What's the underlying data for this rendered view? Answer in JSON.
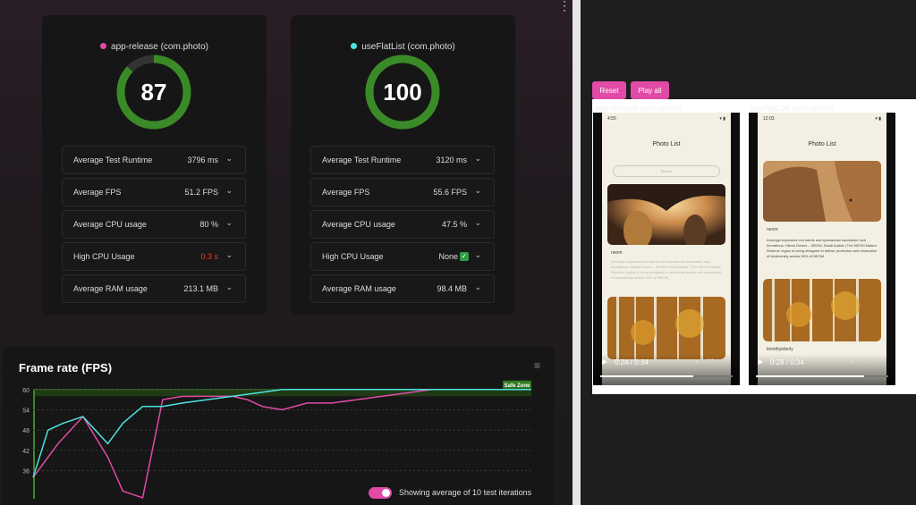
{
  "cards": [
    {
      "title": "app-release (com.photo)",
      "color": "#e14aa6",
      "score": "87",
      "score_value": 87,
      "metrics": [
        {
          "label": "Average Test Runtime",
          "value": "3796 ms"
        },
        {
          "label": "Average FPS",
          "value": "51.2 FPS"
        },
        {
          "label": "Average CPU usage",
          "value": "80 %"
        },
        {
          "label": "High CPU Usage",
          "value": "0.3 s"
        },
        {
          "label": "Average RAM usage",
          "value": "213.1 MB"
        }
      ]
    },
    {
      "title": "useFlatList (com.photo)",
      "color": "#4de3e0",
      "score": "100",
      "score_value": 100,
      "metrics": [
        {
          "label": "Average Test Runtime",
          "value": "3120 ms"
        },
        {
          "label": "Average FPS",
          "value": "55.6 FPS"
        },
        {
          "label": "Average CPU usage",
          "value": "47.5 %"
        },
        {
          "label": "High CPU Usage",
          "value": "None"
        },
        {
          "label": "Average RAM usage",
          "value": "98.4 MB"
        }
      ]
    }
  ],
  "chart": {
    "title": "Frame rate (FPS)",
    "menu_icon": "hamburger-menu-icon",
    "safe_zone_label": "Safe Zone",
    "y_ticks": [
      "60",
      "54",
      "48",
      "42",
      "36"
    ]
  },
  "chart_data": {
    "type": "line",
    "title": "Frame rate (FPS)",
    "ylim": [
      33,
      61
    ],
    "yticks": [
      60,
      54,
      48,
      42,
      36
    ],
    "series": [
      {
        "name": "app-release (com.photo)",
        "color": "#e14aa6",
        "x": [
          0,
          5,
          10,
          15,
          18,
          22,
          26,
          30,
          35,
          40,
          43,
          46,
          50,
          55,
          60,
          65,
          70,
          75,
          80,
          85,
          90,
          95,
          100
        ],
        "y": [
          34,
          44,
          52,
          40,
          30,
          28,
          57,
          58,
          58,
          58,
          57,
          55,
          54,
          56,
          56,
          57,
          58,
          59,
          60,
          60,
          60,
          60,
          60
        ]
      },
      {
        "name": "useFlatList (com.photo)",
        "color": "#4de3e0",
        "x": [
          0,
          3,
          6,
          10,
          15,
          18,
          22,
          26,
          30,
          35,
          40,
          45,
          50,
          55,
          60,
          65,
          70,
          75,
          80,
          85,
          90,
          95,
          100
        ],
        "y": [
          34,
          48,
          50,
          52,
          44,
          50,
          55,
          55,
          56,
          57,
          58,
          59,
          60,
          60,
          60,
          60,
          60,
          60,
          60,
          60,
          60,
          60,
          60
        ]
      }
    ]
  },
  "toggle": {
    "label": "Showing average of 10 test iterations",
    "on": true
  },
  "right": {
    "reset_label": "Reset",
    "play_all_label": "Play all",
    "videos": [
      {
        "title": "app-release (com.photo)",
        "status_time": "4:55",
        "screen_title": "Photo List",
        "search_placeholder": "Search",
        "caption_title": "neom",
        "caption_text": "Amongst expansive red sands and spectacular sandstone rock formations, Hisma Desert – NEOM, Saudi Arabia | The NEOM Nature Reserve region is being designed to deliver protection and restoration of biodiversity across 95% of NEOM",
        "time": "0:24 / 0:34",
        "progress": 0.7
      },
      {
        "title": "useFlatList (com.photo)",
        "status_time": "12:03",
        "screen_title": "Photo List",
        "caption_title": "neom",
        "caption_text": "Amongst expansive red sands and spectacular sandstone rock formations, Hisma Desert – NEOM, Saudi Arabia | The NEOM Nature Reserve region is being designed to deliver protection and restoration of biodiversity across 95% of NEOM",
        "author": "timothyeberly",
        "time": "0:28 / 0:34",
        "progress": 0.82
      }
    ]
  }
}
